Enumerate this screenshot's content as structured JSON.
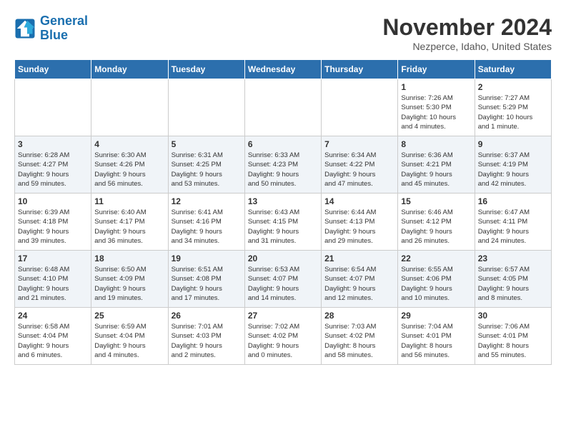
{
  "header": {
    "logo_line1": "General",
    "logo_line2": "Blue",
    "month_title": "November 2024",
    "location": "Nezperce, Idaho, United States"
  },
  "days_of_week": [
    "Sunday",
    "Monday",
    "Tuesday",
    "Wednesday",
    "Thursday",
    "Friday",
    "Saturday"
  ],
  "weeks": [
    [
      {
        "day": "",
        "info": ""
      },
      {
        "day": "",
        "info": ""
      },
      {
        "day": "",
        "info": ""
      },
      {
        "day": "",
        "info": ""
      },
      {
        "day": "",
        "info": ""
      },
      {
        "day": "1",
        "info": "Sunrise: 7:26 AM\nSunset: 5:30 PM\nDaylight: 10 hours\nand 4 minutes."
      },
      {
        "day": "2",
        "info": "Sunrise: 7:27 AM\nSunset: 5:29 PM\nDaylight: 10 hours\nand 1 minute."
      }
    ],
    [
      {
        "day": "3",
        "info": "Sunrise: 6:28 AM\nSunset: 4:27 PM\nDaylight: 9 hours\nand 59 minutes."
      },
      {
        "day": "4",
        "info": "Sunrise: 6:30 AM\nSunset: 4:26 PM\nDaylight: 9 hours\nand 56 minutes."
      },
      {
        "day": "5",
        "info": "Sunrise: 6:31 AM\nSunset: 4:25 PM\nDaylight: 9 hours\nand 53 minutes."
      },
      {
        "day": "6",
        "info": "Sunrise: 6:33 AM\nSunset: 4:23 PM\nDaylight: 9 hours\nand 50 minutes."
      },
      {
        "day": "7",
        "info": "Sunrise: 6:34 AM\nSunset: 4:22 PM\nDaylight: 9 hours\nand 47 minutes."
      },
      {
        "day": "8",
        "info": "Sunrise: 6:36 AM\nSunset: 4:21 PM\nDaylight: 9 hours\nand 45 minutes."
      },
      {
        "day": "9",
        "info": "Sunrise: 6:37 AM\nSunset: 4:19 PM\nDaylight: 9 hours\nand 42 minutes."
      }
    ],
    [
      {
        "day": "10",
        "info": "Sunrise: 6:39 AM\nSunset: 4:18 PM\nDaylight: 9 hours\nand 39 minutes."
      },
      {
        "day": "11",
        "info": "Sunrise: 6:40 AM\nSunset: 4:17 PM\nDaylight: 9 hours\nand 36 minutes."
      },
      {
        "day": "12",
        "info": "Sunrise: 6:41 AM\nSunset: 4:16 PM\nDaylight: 9 hours\nand 34 minutes."
      },
      {
        "day": "13",
        "info": "Sunrise: 6:43 AM\nSunset: 4:15 PM\nDaylight: 9 hours\nand 31 minutes."
      },
      {
        "day": "14",
        "info": "Sunrise: 6:44 AM\nSunset: 4:13 PM\nDaylight: 9 hours\nand 29 minutes."
      },
      {
        "day": "15",
        "info": "Sunrise: 6:46 AM\nSunset: 4:12 PM\nDaylight: 9 hours\nand 26 minutes."
      },
      {
        "day": "16",
        "info": "Sunrise: 6:47 AM\nSunset: 4:11 PM\nDaylight: 9 hours\nand 24 minutes."
      }
    ],
    [
      {
        "day": "17",
        "info": "Sunrise: 6:48 AM\nSunset: 4:10 PM\nDaylight: 9 hours\nand 21 minutes."
      },
      {
        "day": "18",
        "info": "Sunrise: 6:50 AM\nSunset: 4:09 PM\nDaylight: 9 hours\nand 19 minutes."
      },
      {
        "day": "19",
        "info": "Sunrise: 6:51 AM\nSunset: 4:08 PM\nDaylight: 9 hours\nand 17 minutes."
      },
      {
        "day": "20",
        "info": "Sunrise: 6:53 AM\nSunset: 4:07 PM\nDaylight: 9 hours\nand 14 minutes."
      },
      {
        "day": "21",
        "info": "Sunrise: 6:54 AM\nSunset: 4:07 PM\nDaylight: 9 hours\nand 12 minutes."
      },
      {
        "day": "22",
        "info": "Sunrise: 6:55 AM\nSunset: 4:06 PM\nDaylight: 9 hours\nand 10 minutes."
      },
      {
        "day": "23",
        "info": "Sunrise: 6:57 AM\nSunset: 4:05 PM\nDaylight: 9 hours\nand 8 minutes."
      }
    ],
    [
      {
        "day": "24",
        "info": "Sunrise: 6:58 AM\nSunset: 4:04 PM\nDaylight: 9 hours\nand 6 minutes."
      },
      {
        "day": "25",
        "info": "Sunrise: 6:59 AM\nSunset: 4:04 PM\nDaylight: 9 hours\nand 4 minutes."
      },
      {
        "day": "26",
        "info": "Sunrise: 7:01 AM\nSunset: 4:03 PM\nDaylight: 9 hours\nand 2 minutes."
      },
      {
        "day": "27",
        "info": "Sunrise: 7:02 AM\nSunset: 4:02 PM\nDaylight: 9 hours\nand 0 minutes."
      },
      {
        "day": "28",
        "info": "Sunrise: 7:03 AM\nSunset: 4:02 PM\nDaylight: 8 hours\nand 58 minutes."
      },
      {
        "day": "29",
        "info": "Sunrise: 7:04 AM\nSunset: 4:01 PM\nDaylight: 8 hours\nand 56 minutes."
      },
      {
        "day": "30",
        "info": "Sunrise: 7:06 AM\nSunset: 4:01 PM\nDaylight: 8 hours\nand 55 minutes."
      }
    ]
  ]
}
